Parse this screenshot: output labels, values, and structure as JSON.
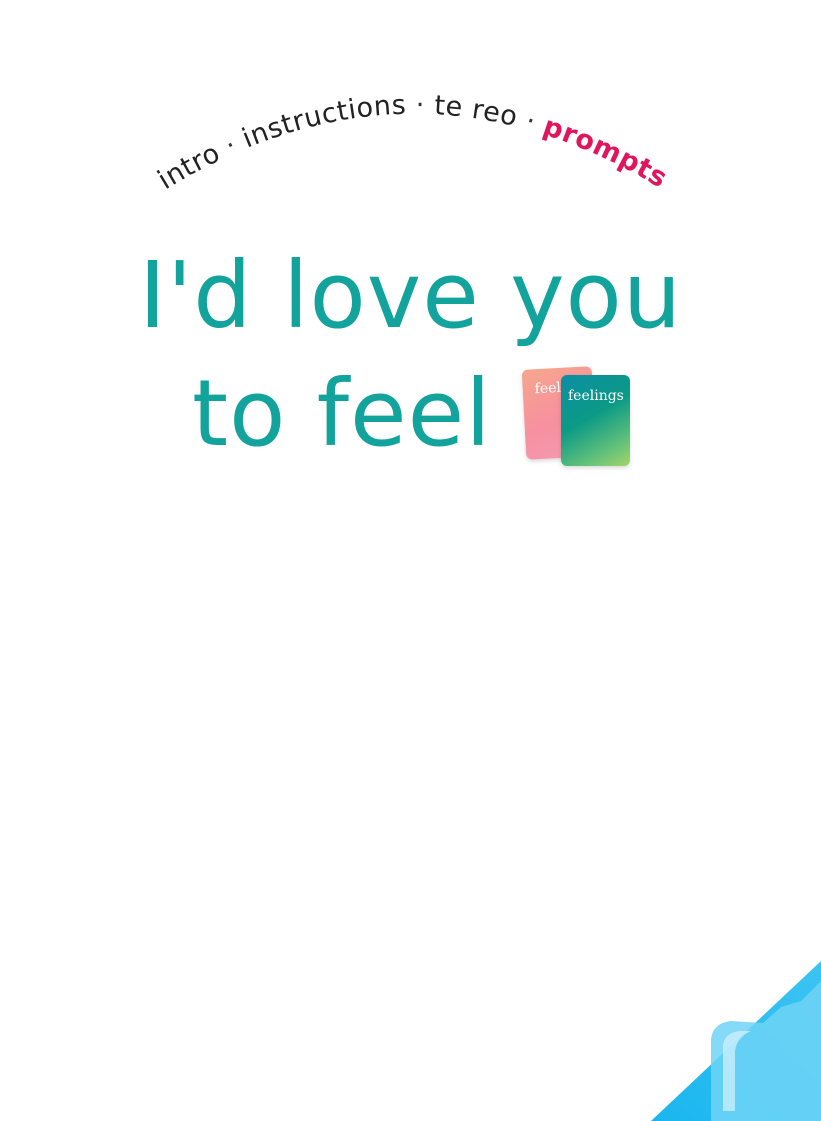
{
  "nav": {
    "items": [
      {
        "label": "intro"
      },
      {
        "label": "instructions"
      },
      {
        "label": "te reo"
      },
      {
        "label": "prompts"
      }
    ],
    "separator": "·",
    "active": "prompts"
  },
  "headline": {
    "line1": "I'd love you",
    "line2": "to feel"
  },
  "cards": {
    "back_label": "feel",
    "front_label": "feelings"
  },
  "colors": {
    "headline": "#12a39c",
    "nav_active": "#e0155c",
    "nav_text": "#222222",
    "corner_accent": "#1ab6ef"
  }
}
